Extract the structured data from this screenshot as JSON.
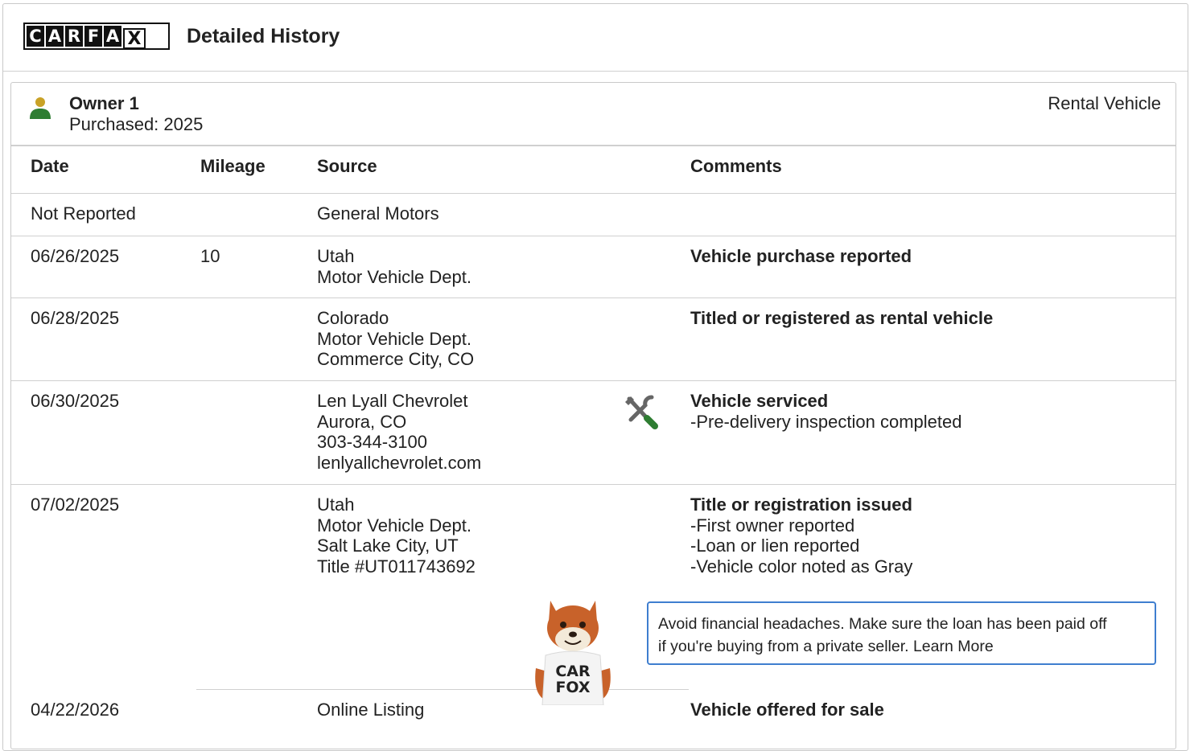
{
  "header": {
    "logo_letters": [
      "C",
      "A",
      "R",
      "F",
      "A",
      "X"
    ],
    "title": "Detailed History"
  },
  "owner": {
    "name": "Owner 1",
    "purchased": "Purchased: 2025",
    "type": "Rental Vehicle"
  },
  "table": {
    "columns": {
      "date": "Date",
      "mileage": "Mileage",
      "source": "Source",
      "comments": "Comments"
    },
    "rows": [
      {
        "date": "Not Reported",
        "mileage": "",
        "source": [
          "General Motors"
        ],
        "comment_title": "",
        "comment_details": []
      },
      {
        "date": "06/26/2025",
        "mileage": "10",
        "source": [
          "Utah",
          "Motor Vehicle Dept."
        ],
        "comment_title": "Vehicle purchase reported",
        "comment_details": []
      },
      {
        "date": "06/28/2025",
        "mileage": "",
        "source": [
          "Colorado",
          "Motor Vehicle Dept.",
          "Commerce City, CO"
        ],
        "comment_title": "Titled or registered as rental vehicle",
        "comment_details": []
      },
      {
        "date": "06/30/2025",
        "mileage": "",
        "source": [
          "Len Lyall Chevrolet",
          "Aurora, CO",
          "303-344-3100",
          "lenlyallchevrolet.com"
        ],
        "icon": "service-tools-icon",
        "comment_title": "Vehicle serviced",
        "comment_details": [
          "-Pre-delivery inspection completed"
        ]
      },
      {
        "date": "07/02/2025",
        "mileage": "",
        "source": [
          "Utah",
          "Motor Vehicle Dept.",
          "Salt Lake City, UT",
          "Title #UT011743692"
        ],
        "comment_title": "Title or registration issued",
        "comment_details": [
          "-First owner reported",
          "-Loan or lien reported",
          "-Vehicle color noted as Gray"
        ]
      },
      {
        "date": "04/22/2026",
        "mileage": "",
        "source": [
          "Online Listing"
        ],
        "comment_title": "Vehicle offered for sale",
        "comment_details": []
      }
    ]
  },
  "tip": {
    "line1": "Avoid financial headaches. Make sure the loan has been paid off",
    "line2": "if you're buying from a private seller. Learn More"
  },
  "fox_shirt": {
    "line1": "CAR",
    "line2": "FOX"
  },
  "colors": {
    "tip_border": "#3f7ecf",
    "person_head": "#c9a227",
    "person_body": "#2e7d32",
    "tools_green": "#2e7d32",
    "tools_gray": "#666666",
    "fox_orange": "#c8622a"
  }
}
